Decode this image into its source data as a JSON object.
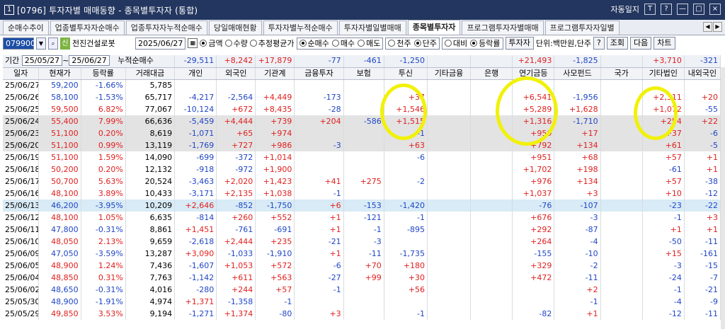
{
  "window": {
    "num": "1",
    "title": "[0796] 투자자별 매매동향 - 종목별투자자 (통합)",
    "auto_label": "자동일지",
    "icons": [
      "T",
      "?",
      "—",
      "□",
      "×"
    ]
  },
  "tabs": [
    "순매수추이",
    "업종별투자자순매수",
    "업종투자자누적순매수",
    "당일매매현황",
    "투자자별누적순매수",
    "투자자별일별매매",
    "종목별투자자",
    "프로그램투자자별매매",
    "프로그램투자자일별"
  ],
  "active_tab": 6,
  "controls": {
    "code": "079900",
    "sym": "신",
    "name": "전진건설로봇",
    "date": "2025/06/27",
    "radio1": [
      "금액",
      "수량",
      "추정평균가"
    ],
    "radio2": [
      "순매수",
      "매수",
      "매도"
    ],
    "radio3": [
      "천주",
      "단주"
    ],
    "radio4": [
      "대비",
      "등락률"
    ],
    "investor_btn": "투자자",
    "unit": "단위:백만원,단주",
    "help": "?",
    "search": "조회",
    "next": "다음",
    "chart": "차트"
  },
  "period": {
    "label": "기간",
    "from": "25/05/27",
    "tilde": "~",
    "to": "25/06/27",
    "sum_label": "누적순매수"
  },
  "summary": [
    "-29,511",
    "+8,242",
    "+17,879",
    "-77",
    "-461",
    "-1,250",
    "",
    "",
    "+21,493",
    "-1,825",
    "",
    "+3,710",
    "-321"
  ],
  "headers": [
    "일자",
    "현재가",
    "등락률",
    "거래대금",
    "개인",
    "외국인",
    "기관계",
    "금융투자",
    "보험",
    "투신",
    "기타금융",
    "은행",
    "연기금등",
    "사모펀드",
    "국가",
    "기타법인",
    "내외국인"
  ],
  "rows": [
    [
      "25/06/27",
      "59,200",
      "-1.66%",
      "5,785",
      "",
      "",
      "",
      "",
      "",
      "",
      "",
      "",
      "",
      "",
      "",
      "",
      ""
    ],
    [
      "25/06/26",
      "58,100",
      "-1.53%",
      "65,717",
      "-4,217",
      "-2,564",
      "+4,449",
      "-173",
      "",
      "+37",
      "",
      "",
      "+6,541",
      "-1,956",
      "",
      "+2,311",
      "+20"
    ],
    [
      "25/06/25",
      "59,500",
      "6.82%",
      "77,067",
      "-10,124",
      "+672",
      "+8,435",
      "-28",
      "",
      "+1,546",
      "",
      "",
      "+5,289",
      "+1,628",
      "",
      "+1,072",
      "-55"
    ],
    [
      "25/06/24",
      "55,400",
      "7.99%",
      "66,636",
      "-5,459",
      "+4,444",
      "+739",
      "+204",
      "-586",
      "+1,515",
      "",
      "",
      "+1,316",
      "-1,710",
      "",
      "+254",
      "+22"
    ],
    [
      "25/06/23",
      "51,100",
      "0.20%",
      "8,619",
      "-1,071",
      "+65",
      "+974",
      "",
      "",
      "-1",
      "",
      "",
      "+959",
      "+17",
      "",
      "+37",
      "-6"
    ],
    [
      "25/06/20",
      "51,100",
      "0.99%",
      "13,119",
      "-1,769",
      "+727",
      "+986",
      "-3",
      "",
      "+63",
      "",
      "",
      "+792",
      "+134",
      "",
      "+61",
      "-5"
    ],
    [
      "25/06/19",
      "51,100",
      "1.59%",
      "14,090",
      "-699",
      "-372",
      "+1,014",
      "",
      "",
      "-6",
      "",
      "",
      "+951",
      "+68",
      "",
      "+57",
      "+1"
    ],
    [
      "25/06/18",
      "50,200",
      "0.20%",
      "12,132",
      "-918",
      "-972",
      "+1,900",
      "",
      "",
      "",
      "",
      "",
      "+1,702",
      "+198",
      "",
      "-61",
      "+1"
    ],
    [
      "25/06/17",
      "50,700",
      "5.63%",
      "20,524",
      "-3,463",
      "+2,020",
      "+1,423",
      "+41",
      "+275",
      "-2",
      "",
      "",
      "+976",
      "+134",
      "",
      "+57",
      "-38"
    ],
    [
      "25/06/16",
      "48,100",
      "3.89%",
      "10,433",
      "-3,171",
      "+2,135",
      "+1,038",
      "-1",
      "",
      "",
      "",
      "",
      "+1,037",
      "+3",
      "",
      "+10",
      "-12"
    ],
    [
      "25/06/13",
      "46,200",
      "-3.95%",
      "10,209",
      "+2,646",
      "-852",
      "-1,750",
      "+6",
      "-153",
      "-1,420",
      "",
      "",
      "-76",
      "-107",
      "",
      "-23",
      "-22"
    ],
    [
      "25/06/12",
      "48,100",
      "1.05%",
      "6,635",
      "-814",
      "+260",
      "+552",
      "+1",
      "-121",
      "-1",
      "",
      "",
      "+676",
      "-3",
      "",
      "-1",
      "+3"
    ],
    [
      "25/06/11",
      "47,800",
      "-0.31%",
      "8,861",
      "+1,451",
      "-761",
      "-691",
      "+1",
      "-1",
      "-895",
      "",
      "",
      "+292",
      "-87",
      "",
      "+1",
      "+1"
    ],
    [
      "25/06/10",
      "48,050",
      "2.13%",
      "9,659",
      "-2,618",
      "+2,444",
      "+235",
      "-21",
      "-3",
      "",
      "",
      "",
      "+264",
      "-4",
      "",
      "-50",
      "-11"
    ],
    [
      "25/06/09",
      "47,050",
      "-3.59%",
      "13,287",
      "+3,090",
      "-1,033",
      "-1,910",
      "+1",
      "-11",
      "-1,735",
      "",
      "",
      "-155",
      "-10",
      "",
      "+15",
      "-161"
    ],
    [
      "25/06/05",
      "48,900",
      "1.24%",
      "7,436",
      "-1,607",
      "+1,053",
      "+572",
      "-6",
      "+70",
      "+180",
      "",
      "",
      "+329",
      "-2",
      "",
      "-3",
      "-15"
    ],
    [
      "25/06/04",
      "48,850",
      "0.31%",
      "7,763",
      "-1,142",
      "+611",
      "+563",
      "-27",
      "+99",
      "+30",
      "",
      "",
      "+472",
      "-11",
      "",
      "-24",
      "-7"
    ],
    [
      "25/06/02",
      "48,650",
      "-0.31%",
      "4,016",
      "-280",
      "+244",
      "+57",
      "-1",
      "",
      "+56",
      "",
      "",
      "",
      "+2",
      "",
      "-1",
      "-21"
    ],
    [
      "25/05/30",
      "48,900",
      "-1.91%",
      "4,974",
      "+1,371",
      "-1,358",
      "-1",
      "",
      "",
      "",
      "",
      "",
      "",
      "-1",
      "",
      "-4",
      "-9"
    ],
    [
      "25/05/29",
      "49,850",
      "3.53%",
      "9,194",
      "-1,271",
      "+1,374",
      "-80",
      "+3",
      "",
      "-1",
      "",
      "",
      "-82",
      "+1",
      "",
      "-12",
      "-11"
    ]
  ]
}
